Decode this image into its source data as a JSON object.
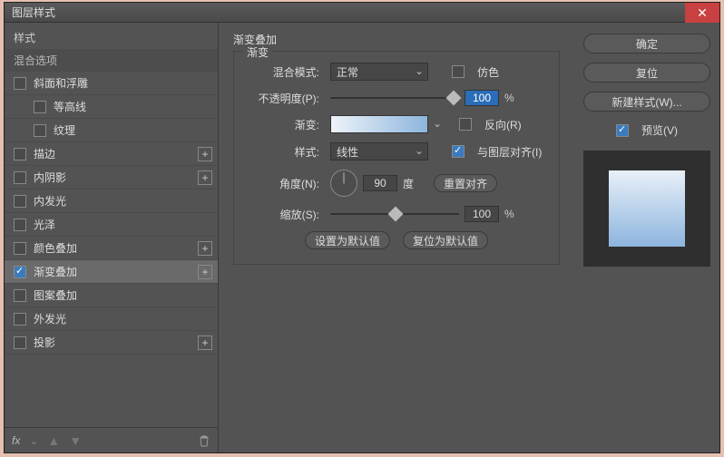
{
  "title": "图层样式",
  "left": {
    "header": "样式",
    "blend": "混合选项",
    "items": [
      {
        "label": "斜面和浮雕",
        "checked": false,
        "plus": false,
        "indent": false
      },
      {
        "label": "等高线",
        "checked": false,
        "plus": false,
        "indent": true
      },
      {
        "label": "纹理",
        "checked": false,
        "plus": false,
        "indent": true
      },
      {
        "label": "描边",
        "checked": false,
        "plus": true,
        "indent": false
      },
      {
        "label": "内阴影",
        "checked": false,
        "plus": true,
        "indent": false
      },
      {
        "label": "内发光",
        "checked": false,
        "plus": false,
        "indent": false
      },
      {
        "label": "光泽",
        "checked": false,
        "plus": false,
        "indent": false
      },
      {
        "label": "颜色叠加",
        "checked": false,
        "plus": true,
        "indent": false
      },
      {
        "label": "渐变叠加",
        "checked": true,
        "plus": true,
        "indent": false,
        "selected": true
      },
      {
        "label": "图案叠加",
        "checked": false,
        "plus": false,
        "indent": false
      },
      {
        "label": "外发光",
        "checked": false,
        "plus": false,
        "indent": false
      },
      {
        "label": "投影",
        "checked": false,
        "plus": true,
        "indent": false
      }
    ],
    "fx": "fx"
  },
  "center": {
    "title": "渐变叠加",
    "legend": "渐变",
    "blend_label": "混合模式:",
    "blend_value": "正常",
    "dither": "仿色",
    "opacity_label": "不透明度(P):",
    "opacity_value": "100",
    "pct": "%",
    "gradient_label": "渐变:",
    "reverse": "反向(R)",
    "style_label": "样式:",
    "style_value": "线性",
    "align": "与图层对齐(I)",
    "angle_label": "角度(N):",
    "angle_value": "90",
    "angle_unit": "度",
    "reset_align": "重置对齐",
    "scale_label": "缩放(S):",
    "scale_value": "100",
    "btn_default": "设置为默认值",
    "btn_reset": "复位为默认值"
  },
  "right": {
    "ok": "确定",
    "cancel": "复位",
    "new_style": "新建样式(W)...",
    "preview": "预览(V)"
  }
}
